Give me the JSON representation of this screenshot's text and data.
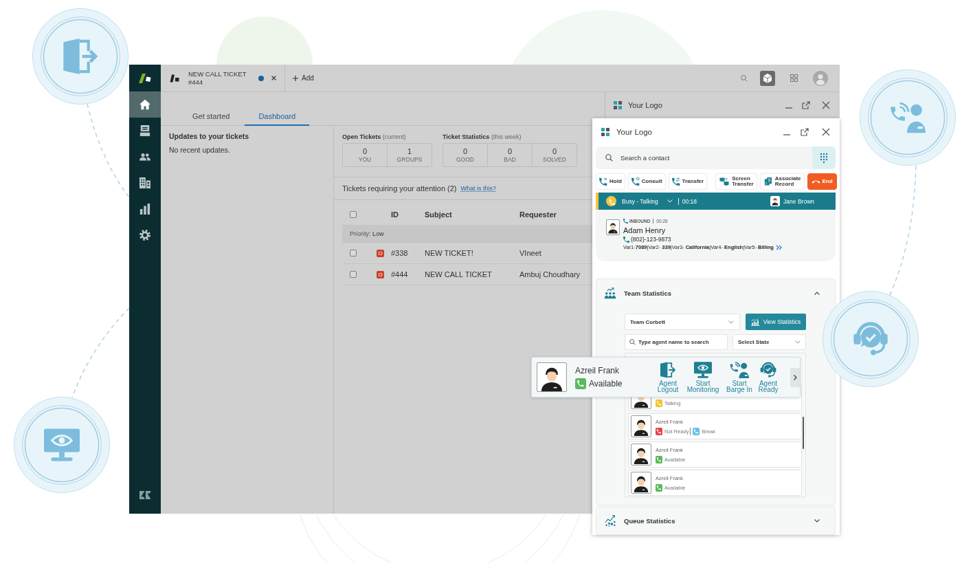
{
  "app_window": {
    "sidebar": {
      "items": [
        {
          "kind": "home",
          "selected": true
        },
        {
          "kind": "views",
          "selected": false
        },
        {
          "kind": "customers",
          "selected": false
        },
        {
          "kind": "organizations",
          "selected": false
        },
        {
          "kind": "reporting",
          "selected": false
        },
        {
          "kind": "admin",
          "selected": false
        }
      ]
    },
    "ticket_tab": {
      "title": "NEW CALL TICKET",
      "number": "#444",
      "unsaved": true
    },
    "add_label": "Add",
    "dashboard_tabs": [
      {
        "label": "Get started",
        "selected": false
      },
      {
        "label": "Dashboard",
        "selected": true
      }
    ],
    "updates": {
      "title": "Updates to your tickets",
      "message": "No recent updates."
    },
    "stat_groups": [
      {
        "title": "Open Tickets",
        "note": "(current)",
        "cells": [
          {
            "value": "0",
            "label": "YOU"
          },
          {
            "value": "1",
            "label": "GROUPS"
          }
        ]
      },
      {
        "title": "Ticket Statistics",
        "note": "(this week)",
        "cells": [
          {
            "value": "0",
            "label": "GOOD"
          },
          {
            "value": "0",
            "label": "BAD"
          },
          {
            "value": "0",
            "label": "SOLVED"
          }
        ]
      }
    ],
    "attention": {
      "title": "Tickets requiring your attention (2)",
      "link": "What is this?"
    },
    "table": {
      "all_checked": false,
      "columns": [
        "ID",
        "Subject",
        "Requester"
      ],
      "group": "Priority: **Low**",
      "rows": [
        {
          "checked": false,
          "status": "O",
          "id": "#338",
          "subject": "NEW TICKET!",
          "requester": "VIneet"
        },
        {
          "checked": false,
          "status": "O",
          "id": "#444",
          "subject": "NEW CALL TICKET",
          "requester": "Ambuj Choudhary"
        }
      ]
    },
    "side_panel": {
      "title": "Your Logo"
    }
  },
  "softphone": {
    "title": "Your Logo",
    "search": {
      "placeholder": "Search a contact"
    },
    "actions": [
      {
        "kind": "hold",
        "label": "Hold"
      },
      {
        "kind": "consult",
        "label": "Consult"
      },
      {
        "kind": "transfer",
        "label": "Transfer"
      },
      {
        "kind": "screen-transfer",
        "label": "Screen Transfer"
      },
      {
        "kind": "associate",
        "label": "Associate Record"
      },
      {
        "kind": "end",
        "label": "End"
      }
    ],
    "status": {
      "label": "Busy - Talking",
      "timer": "00:18",
      "agent": "Jane Brown"
    },
    "call": {
      "direction": "INBOUND",
      "duration": "00:26",
      "caller": "Adam Henry",
      "phone": "(802)-123-9873",
      "variables": "Var1-**7089**|Var2- **339**|Var3- **California**|Var4- **English**|Var5- **Billing**"
    },
    "sections": [
      {
        "kind": "team",
        "title": "Team Statistics",
        "expanded": true,
        "team": "Team Corbett",
        "button": "View Statistics",
        "search_placeholder": "Type agent name to search",
        "state_placeholder": "Select State",
        "agents": [
          {
            "statuses": [
              {
                "label": "Talking",
                "color": "#f4c430"
              }
            ]
          },
          {
            "name": "Azreil Frank",
            "statuses": [
              {
                "label": "Not Ready",
                "color": "#e5434d"
              },
              {
                "label": "Break",
                "color": "#6cc0e8"
              }
            ]
          },
          {
            "name": "Azreil Frank",
            "statuses": [
              {
                "label": "Available",
                "color": "#5cb85c"
              }
            ]
          },
          {
            "name": "Azreil Frank",
            "statuses": [
              {
                "label": "Available",
                "color": "#5cb85c"
              }
            ]
          }
        ]
      },
      {
        "kind": "queue",
        "title": "Queue Statistics",
        "expanded": false
      }
    ]
  },
  "agent_card": {
    "name": "Azreil Frank",
    "status": {
      "label": "Available",
      "color": "#5cb85c"
    },
    "actions": [
      {
        "kind": "logout",
        "label": "Agent Logout"
      },
      {
        "kind": "monitor",
        "label": "Start Monitoring"
      },
      {
        "kind": "barge",
        "label": "Start Barge In"
      },
      {
        "kind": "ready",
        "label": "Agent Ready"
      }
    ]
  }
}
